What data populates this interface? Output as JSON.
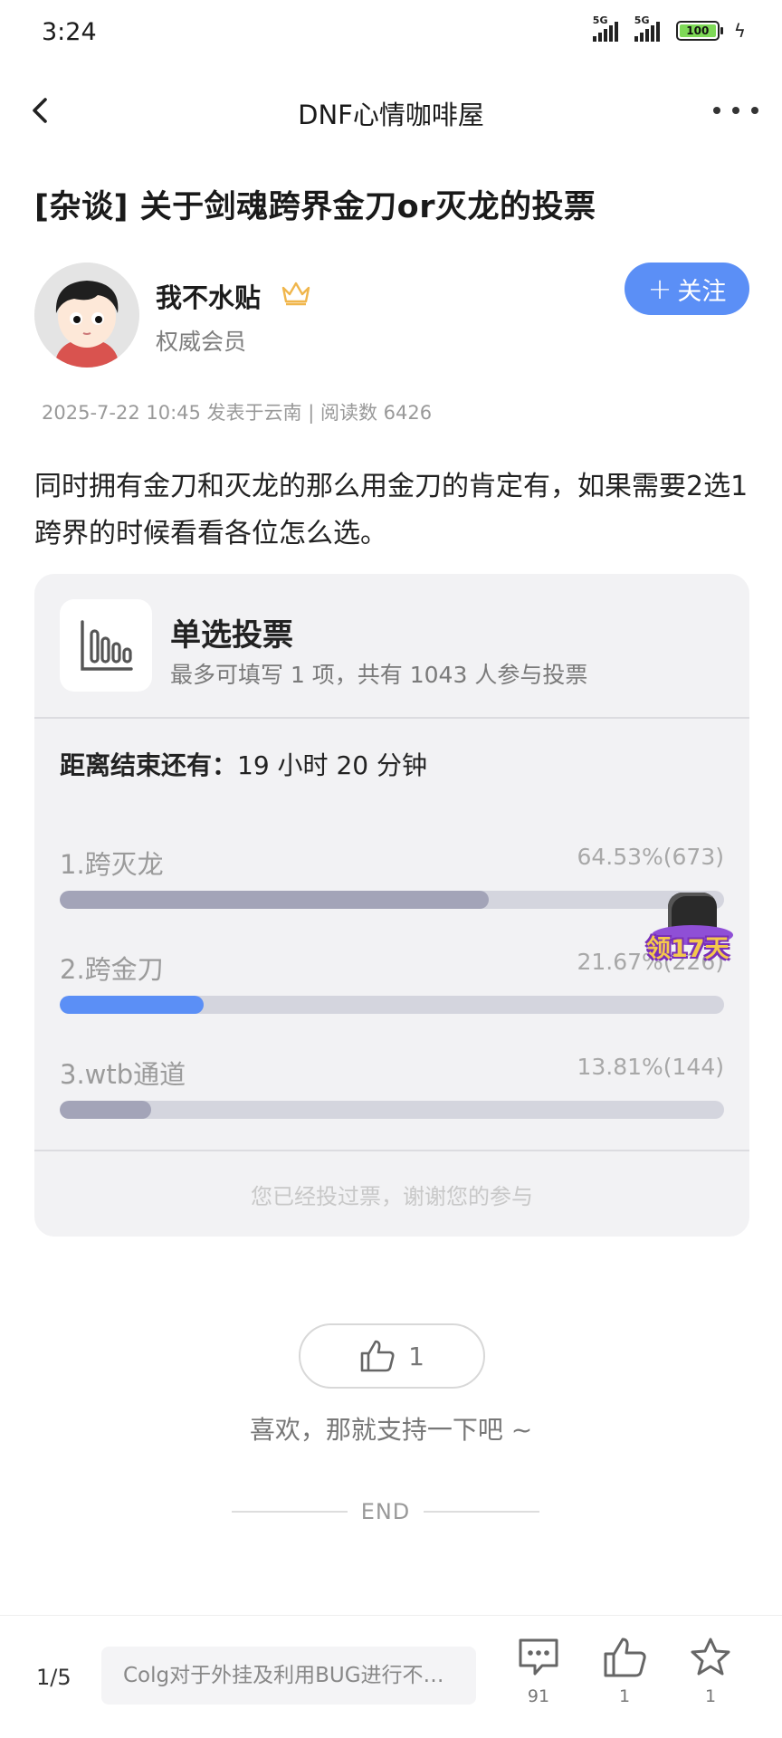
{
  "status_bar": {
    "time": "3:24",
    "signal1_label": "5G",
    "signal2_label": "5G",
    "battery": "100"
  },
  "nav": {
    "title": "DNF心情咖啡屋"
  },
  "post": {
    "title": "[杂谈] 关于剑魂跨界金刀or灭龙的投票",
    "author": {
      "name": "我不水贴",
      "badge": "权威会员",
      "follow_label": "关注"
    },
    "meta": "2025-7-22 10:45 发表于云南 | 阅读数 6426",
    "body": "同时拥有金刀和灭龙的那么用金刀的肯定有，如果需要2选1跨界的时候看看各位怎么选。"
  },
  "poll": {
    "type": "单选投票",
    "rule": "最多可填写 1 项，共有 1043 人参与投票",
    "deadline_label": "距离结束还有：",
    "deadline_value": "19 小时 20 分钟",
    "options": [
      {
        "label": "1.跨灭龙",
        "stats": "64.53%(673)",
        "percent": 64.53,
        "color": "#a3a4b8"
      },
      {
        "label": "2.跨金刀",
        "stats": "21.67%(226)",
        "percent": 21.67,
        "color": "#5b8ff6"
      },
      {
        "label": "3.wtb通道",
        "stats": "13.81%(144)",
        "percent": 13.81,
        "color": "#a3a4b8"
      }
    ],
    "footer": "您已经投过票，谢谢您的参与"
  },
  "promo": {
    "text": "领17天"
  },
  "like": {
    "count": "1",
    "hint": "喜欢，那就支持一下吧 ~"
  },
  "end_label": "END",
  "bottom_bar": {
    "page": "1/5",
    "next_post": "Colg对于外挂及利用BUG进行不…",
    "comments": "91",
    "likes": "1",
    "favorites": "1"
  }
}
